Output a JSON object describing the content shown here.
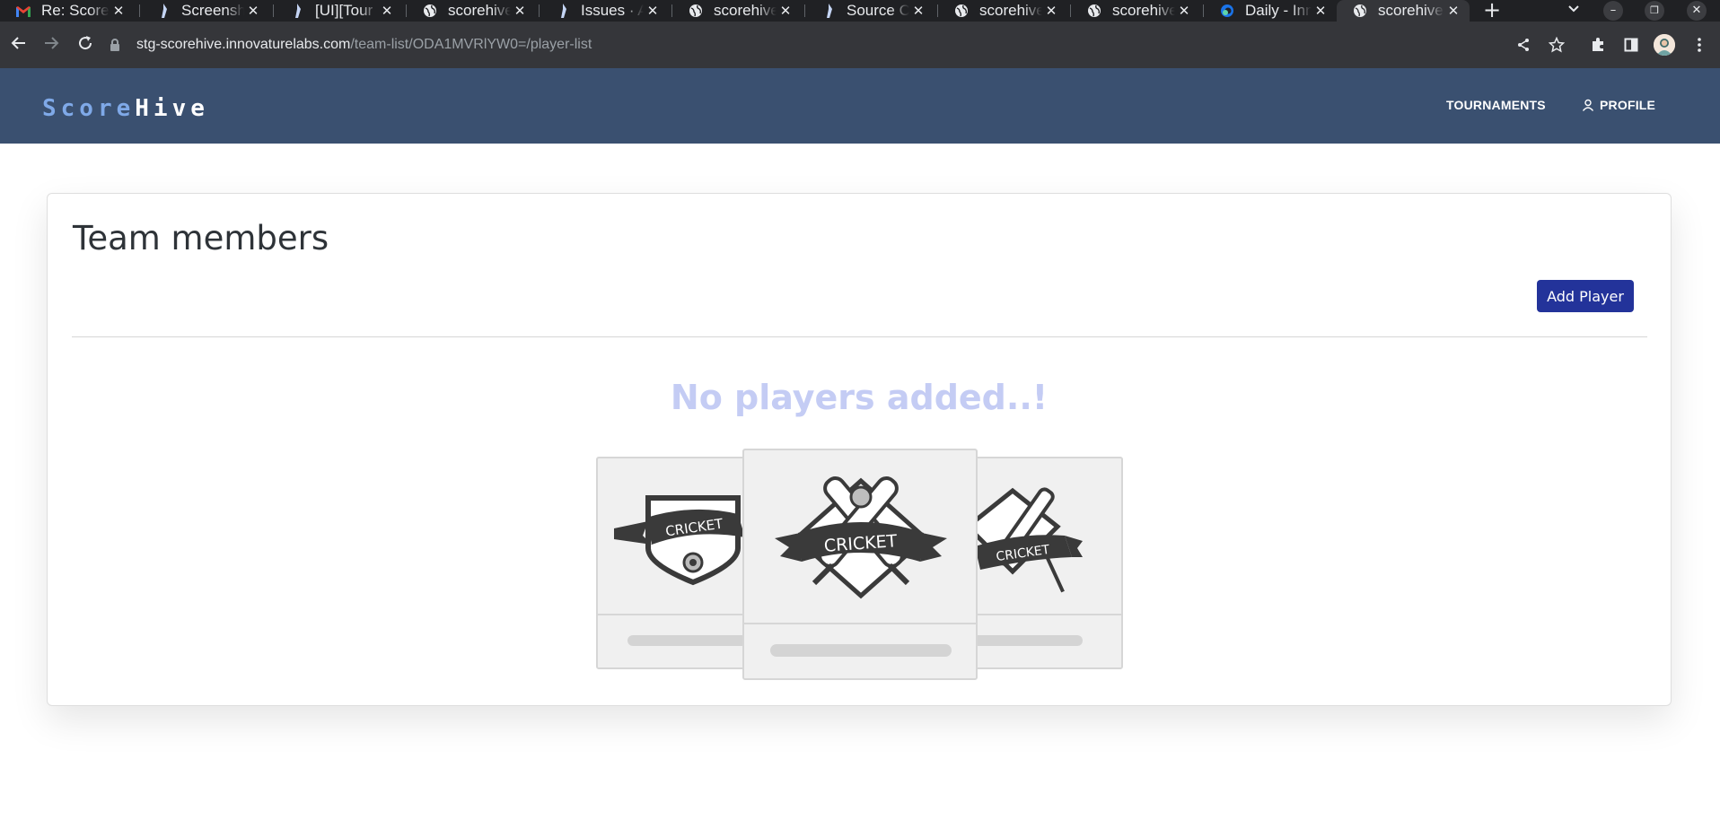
{
  "browser": {
    "tabs": [
      {
        "title": "Re: Score",
        "icon": "gmail-icon"
      },
      {
        "title": "Screensho",
        "icon": "jira-icon"
      },
      {
        "title": "[UI][Tour",
        "icon": "jira-icon"
      },
      {
        "title": "scorehive",
        "icon": "globe-icon"
      },
      {
        "title": "Issues · A",
        "icon": "jira-icon"
      },
      {
        "title": "scorehive",
        "icon": "globe-icon"
      },
      {
        "title": "Source Co",
        "icon": "jira-icon"
      },
      {
        "title": "scorehive",
        "icon": "globe-icon"
      },
      {
        "title": "scorehive",
        "icon": "globe-icon"
      },
      {
        "title": "Daily - Inn",
        "icon": "edge-icon"
      },
      {
        "title": "scorehive",
        "icon": "globe-icon",
        "active": true
      }
    ],
    "url": {
      "host": "stg-scorehive.innovaturelabs.com",
      "path": "/team-list/ODA1MVRlYW0=/player-list"
    }
  },
  "app": {
    "logo_left": "Score",
    "logo_right": "Hive",
    "nav": {
      "tournaments": "TOURNAMENTS",
      "profile": "PROFILE"
    }
  },
  "page": {
    "title": "Team members",
    "add_button": "Add Player",
    "empty_message": "No players added..!",
    "illustration_label": "CRICKET"
  },
  "colors": {
    "appbar": "#3a5070",
    "primary_button": "#23339a",
    "empty_text": "#c4ccf4"
  }
}
